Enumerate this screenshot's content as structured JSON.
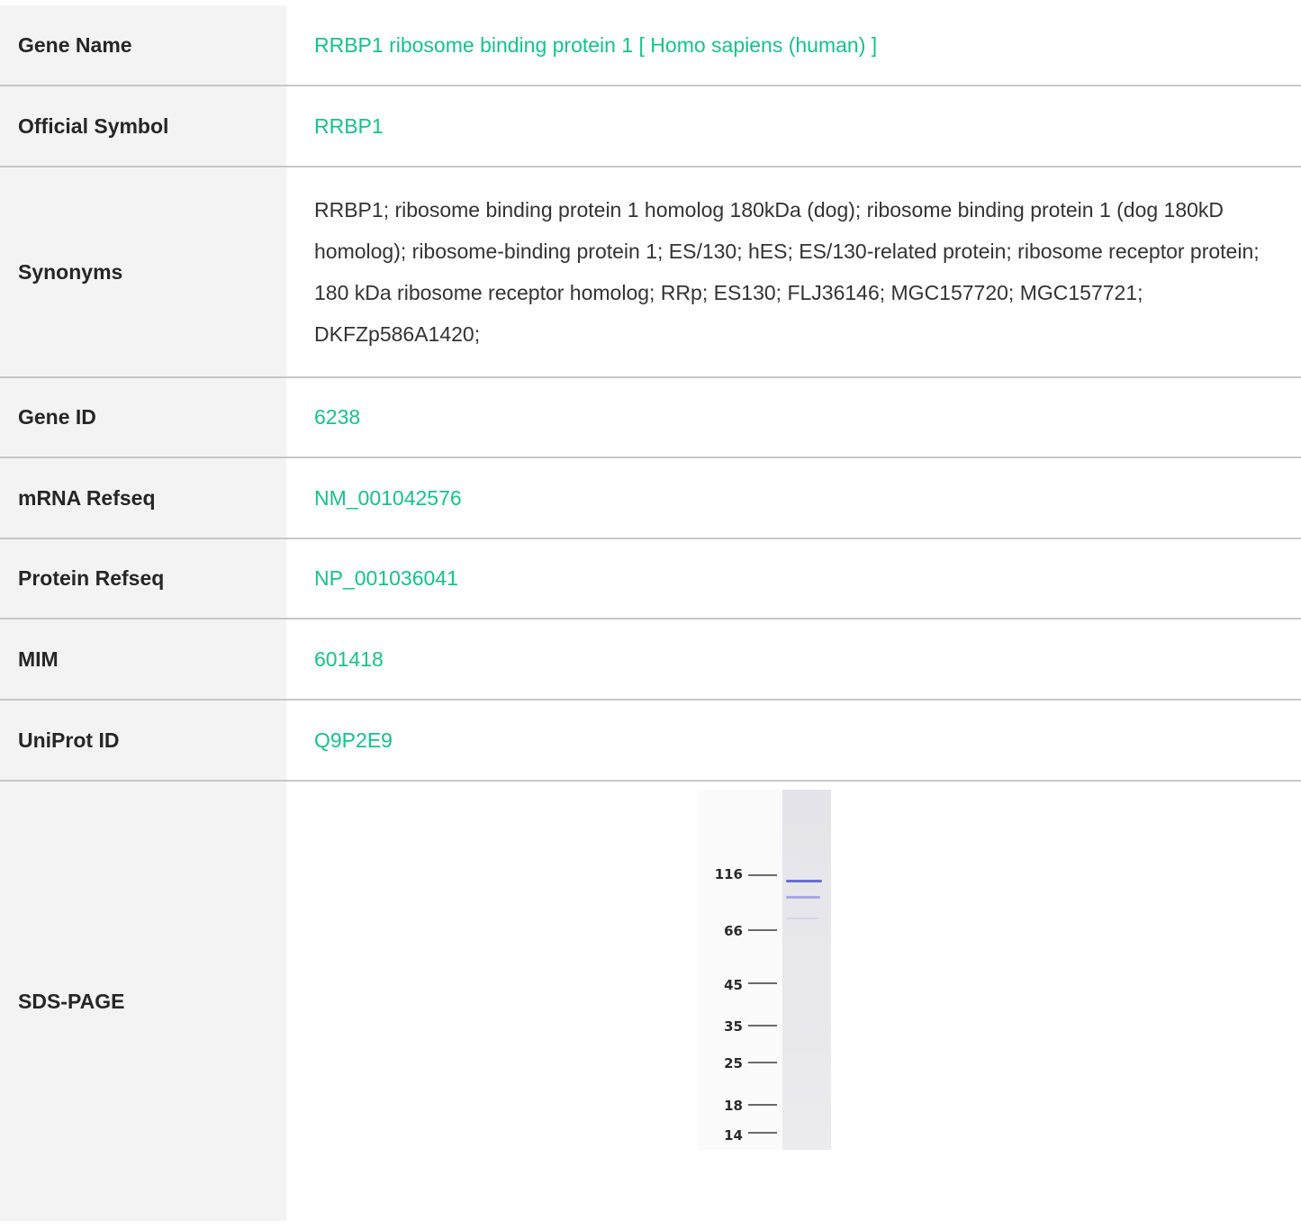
{
  "rows": {
    "gene_name": {
      "label": "Gene Name",
      "value": "RRBP1 ribosome binding protein 1 [ Homo sapiens (human) ]"
    },
    "official_symbol": {
      "label": "Official Symbol",
      "value": "RRBP1"
    },
    "synonyms": {
      "label": "Synonyms",
      "value": "RRBP1; ribosome binding protein 1 homolog 180kDa (dog); ribosome binding protein 1 (dog 180kD homolog); ribosome-binding protein 1; ES/130; hES; ES/130-related protein; ribosome receptor protein; 180 kDa ribosome receptor homolog; RRp; ES130; FLJ36146; MGC157720; MGC157721; DKFZp586A1420;"
    },
    "gene_id": {
      "label": "Gene ID",
      "value": "6238"
    },
    "mrna_refseq": {
      "label": "mRNA Refseq",
      "value": "NM_001042576"
    },
    "protein_refseq": {
      "label": "Protein Refseq",
      "value": "NP_001036041"
    },
    "mim": {
      "label": "MIM",
      "value": "601418"
    },
    "uniprot_id": {
      "label": "UniProt ID",
      "value": "Q9P2E9"
    },
    "sds_page": {
      "label": "SDS-PAGE",
      "markers": [
        "116",
        "66",
        "45",
        "35",
        "25",
        "18",
        "14"
      ]
    }
  },
  "colors": {
    "link": "#16c28c",
    "label_bg": "#f3f3f3",
    "divider": "#c7c7c7",
    "band": "#5a5fd6"
  }
}
